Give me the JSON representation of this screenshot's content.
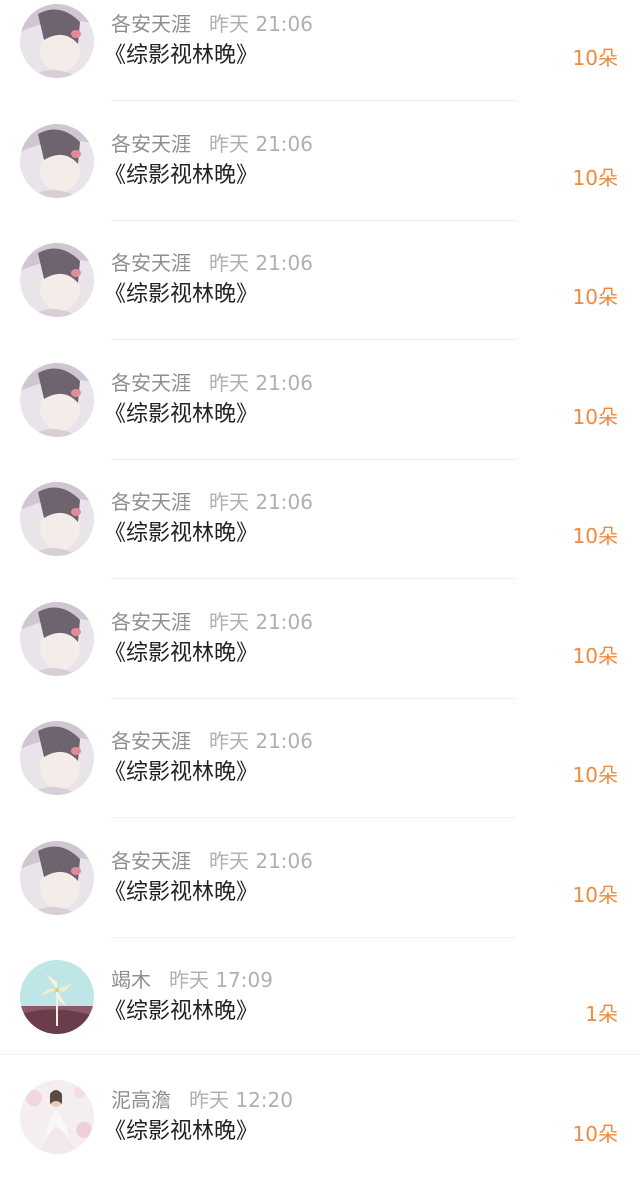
{
  "gifts": [
    {
      "user": "各安天涯",
      "time": "昨天 21:06",
      "book": "《综影视林晚》",
      "count": "10朵",
      "avatar": "portrait-girl-icon"
    },
    {
      "user": "各安天涯",
      "time": "昨天 21:06",
      "book": "《综影视林晚》",
      "count": "10朵",
      "avatar": "portrait-girl-icon"
    },
    {
      "user": "各安天涯",
      "time": "昨天 21:06",
      "book": "《综影视林晚》",
      "count": "10朵",
      "avatar": "portrait-girl-icon"
    },
    {
      "user": "各安天涯",
      "time": "昨天 21:06",
      "book": "《综影视林晚》",
      "count": "10朵",
      "avatar": "portrait-girl-icon"
    },
    {
      "user": "各安天涯",
      "time": "昨天 21:06",
      "book": "《综影视林晚》",
      "count": "10朵",
      "avatar": "portrait-girl-icon"
    },
    {
      "user": "各安天涯",
      "time": "昨天 21:06",
      "book": "《综影视林晚》",
      "count": "10朵",
      "avatar": "portrait-girl-icon"
    },
    {
      "user": "各安天涯",
      "time": "昨天 21:06",
      "book": "《综影视林晚》",
      "count": "10朵",
      "avatar": "portrait-girl-icon"
    },
    {
      "user": "各安天涯",
      "time": "昨天 21:06",
      "book": "《综影视林晚》",
      "count": "10朵",
      "avatar": "portrait-girl-icon"
    },
    {
      "user": "竭木",
      "time": "昨天 17:09",
      "book": "《综影视林晚》",
      "count": "1朵",
      "avatar": "pinwheel-icon"
    },
    {
      "user": "泥高澹",
      "time": "昨天 12:20",
      "book": "《综影视林晚》",
      "count": "10朵",
      "avatar": "bride-icon"
    }
  ],
  "colors": {
    "accent": "#f08a3c",
    "username": "#8e8e8e",
    "title": "#222222",
    "divider": "#eeeeee"
  }
}
